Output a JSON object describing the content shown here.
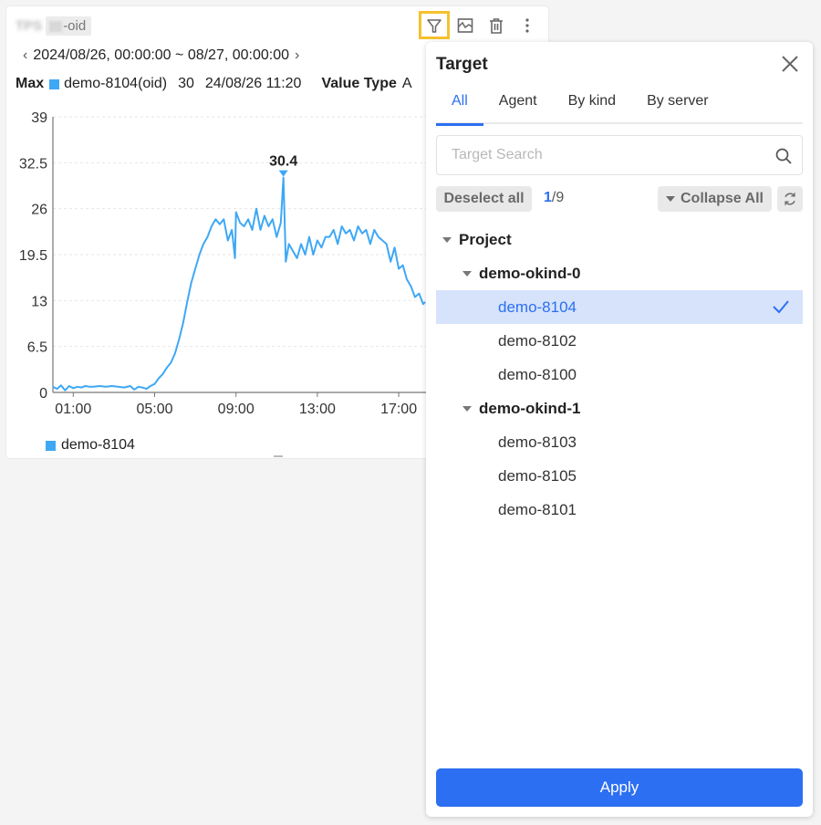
{
  "widget": {
    "title_blurred": "TPS",
    "title_suffix": "-oid",
    "date_range": "2024/08/26, 00:00:00 ~ 08/27, 00:00:00",
    "max_row": {
      "label": "Max",
      "series": "demo-8104(oid)",
      "value": "30",
      "time": "24/08/26 11:20",
      "value_type_label": "Value Type",
      "value_type_value": "A"
    },
    "tools": [
      "filter-icon",
      "chart-icon",
      "trash-icon",
      "more-vertical-icon"
    ],
    "legend": [
      {
        "name": "demo-8104",
        "color": "#3ea8f5"
      }
    ]
  },
  "chart_data": {
    "type": "line",
    "title": "",
    "xlabel": "",
    "ylabel": "",
    "ylim": [
      0,
      39
    ],
    "yticks": [
      "0",
      "6.5",
      "13",
      "19.5",
      "26",
      "32.5",
      "39"
    ],
    "xticks": [
      "01:00",
      "05:00",
      "09:00",
      "13:00",
      "17:00"
    ],
    "x_unit": "hours since 00:00",
    "xlim": [
      0,
      18.3
    ],
    "grid": true,
    "legend_position": "bottom-left",
    "peak_annotation": {
      "x": 11.33,
      "value": 30.4,
      "label": "30.4"
    },
    "series": [
      {
        "name": "demo-8104",
        "color": "#3ea8f5",
        "x": [
          0,
          0.2,
          0.4,
          0.6,
          0.8,
          1.0,
          1.2,
          1.4,
          1.6,
          1.8,
          2.0,
          2.3,
          2.6,
          2.9,
          3.2,
          3.5,
          3.8,
          4.0,
          4.2,
          4.4,
          4.6,
          4.8,
          5.0,
          5.2,
          5.4,
          5.6,
          5.8,
          6.0,
          6.2,
          6.4,
          6.6,
          6.8,
          7.0,
          7.2,
          7.4,
          7.6,
          7.8,
          8.0,
          8.2,
          8.4,
          8.6,
          8.8,
          8.95,
          9.0,
          9.2,
          9.4,
          9.6,
          9.8,
          10.0,
          10.2,
          10.4,
          10.6,
          10.8,
          11.0,
          11.2,
          11.33,
          11.45,
          11.6,
          11.8,
          12.0,
          12.2,
          12.4,
          12.6,
          12.8,
          13.0,
          13.2,
          13.4,
          13.6,
          13.8,
          14.0,
          14.2,
          14.4,
          14.6,
          14.8,
          15.0,
          15.2,
          15.4,
          15.6,
          15.8,
          16.0,
          16.2,
          16.4,
          16.6,
          16.8,
          17.0,
          17.2,
          17.4,
          17.6,
          17.8,
          18.0,
          18.2,
          18.3
        ],
        "values": [
          0.8,
          0.5,
          1.0,
          0.3,
          0.9,
          0.6,
          0.8,
          0.7,
          0.9,
          0.8,
          0.8,
          0.9,
          0.8,
          0.9,
          0.8,
          0.7,
          0.9,
          0.4,
          0.8,
          0.7,
          0.5,
          0.9,
          1.2,
          2.0,
          2.6,
          3.5,
          4.2,
          5.5,
          7.5,
          9.8,
          12.8,
          15.5,
          17.5,
          19.5,
          21.0,
          22.0,
          23.5,
          24.5,
          23.8,
          24.5,
          21.5,
          23.0,
          19.0,
          25.5,
          24.0,
          23.5,
          24.5,
          23.0,
          26.0,
          23.0,
          25.0,
          23.5,
          24.5,
          22.0,
          24.0,
          30.4,
          18.5,
          21.0,
          20.0,
          19.0,
          21.0,
          19.5,
          22.0,
          19.5,
          21.5,
          20.5,
          22.0,
          22.0,
          23.0,
          21.0,
          23.5,
          22.5,
          23.0,
          21.5,
          23.5,
          22.5,
          23.0,
          21.0,
          23.0,
          22.0,
          21.5,
          21.0,
          18.5,
          20.5,
          17.5,
          18.0,
          16.0,
          15.0,
          13.5,
          14.0,
          12.5,
          12.8
        ]
      }
    ]
  },
  "panel": {
    "title": "Target",
    "tabs": [
      {
        "label": "All",
        "active": true
      },
      {
        "label": "Agent",
        "active": false
      },
      {
        "label": "By kind",
        "active": false
      },
      {
        "label": "By server",
        "active": false
      }
    ],
    "search_placeholder": "Target Search",
    "search_value": "",
    "deselect_label": "Deselect all",
    "selected_count": "1",
    "total_count": "/9",
    "collapse_label": "Collapse All",
    "tree": {
      "root": "Project",
      "groups": [
        {
          "name": "demo-okind-0",
          "items": [
            {
              "name": "demo-8104",
              "selected": true
            },
            {
              "name": "demo-8102",
              "selected": false
            },
            {
              "name": "demo-8100",
              "selected": false
            }
          ]
        },
        {
          "name": "demo-okind-1",
          "items": [
            {
              "name": "demo-8103",
              "selected": false
            },
            {
              "name": "demo-8105",
              "selected": false
            },
            {
              "name": "demo-8101",
              "selected": false
            }
          ]
        }
      ]
    },
    "apply_label": "Apply",
    "accent_color": "#2c6ff2"
  }
}
